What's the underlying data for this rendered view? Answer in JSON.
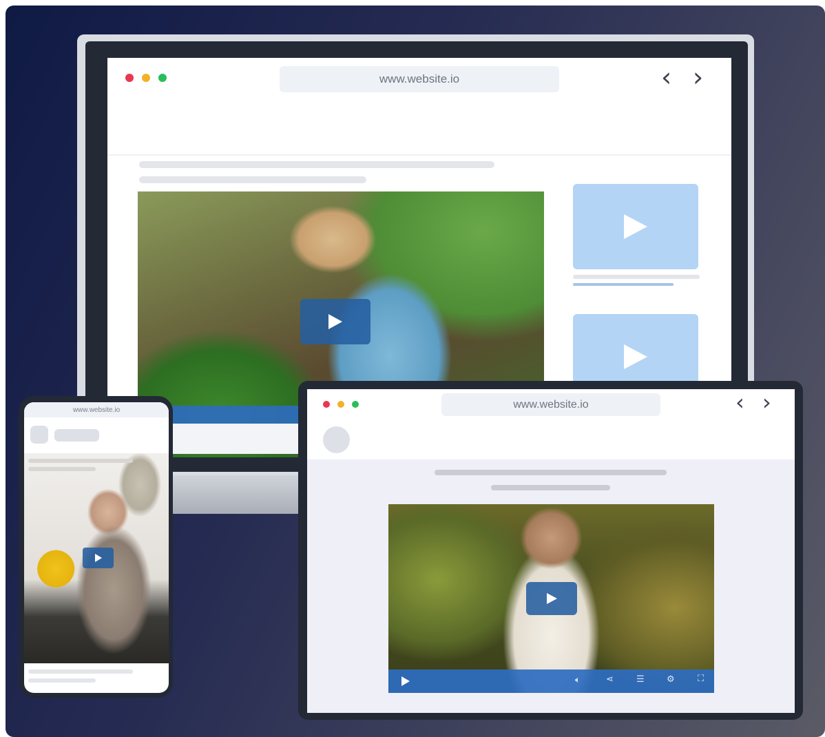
{
  "desktop": {
    "url": "www.website.io",
    "nav_back": "‹",
    "nav_forward": "›"
  },
  "phone": {
    "url": "www.website.io"
  },
  "tablet": {
    "url": "www.website.io",
    "nav_back": "‹",
    "nav_forward": "›"
  },
  "colors": {
    "window_close": "#e8384f",
    "window_minimize": "#f2b12a",
    "window_maximize": "#2bbd5a",
    "play_button": "#255fa0",
    "thumbnail": "#b3d4f5",
    "player_controls": "#2e6cc0"
  },
  "icons": [
    "play-icon",
    "volume-icon",
    "share-icon",
    "playlist-icon",
    "settings-icon",
    "fullscreen-icon",
    "chevron-left-icon",
    "chevron-right-icon"
  ]
}
